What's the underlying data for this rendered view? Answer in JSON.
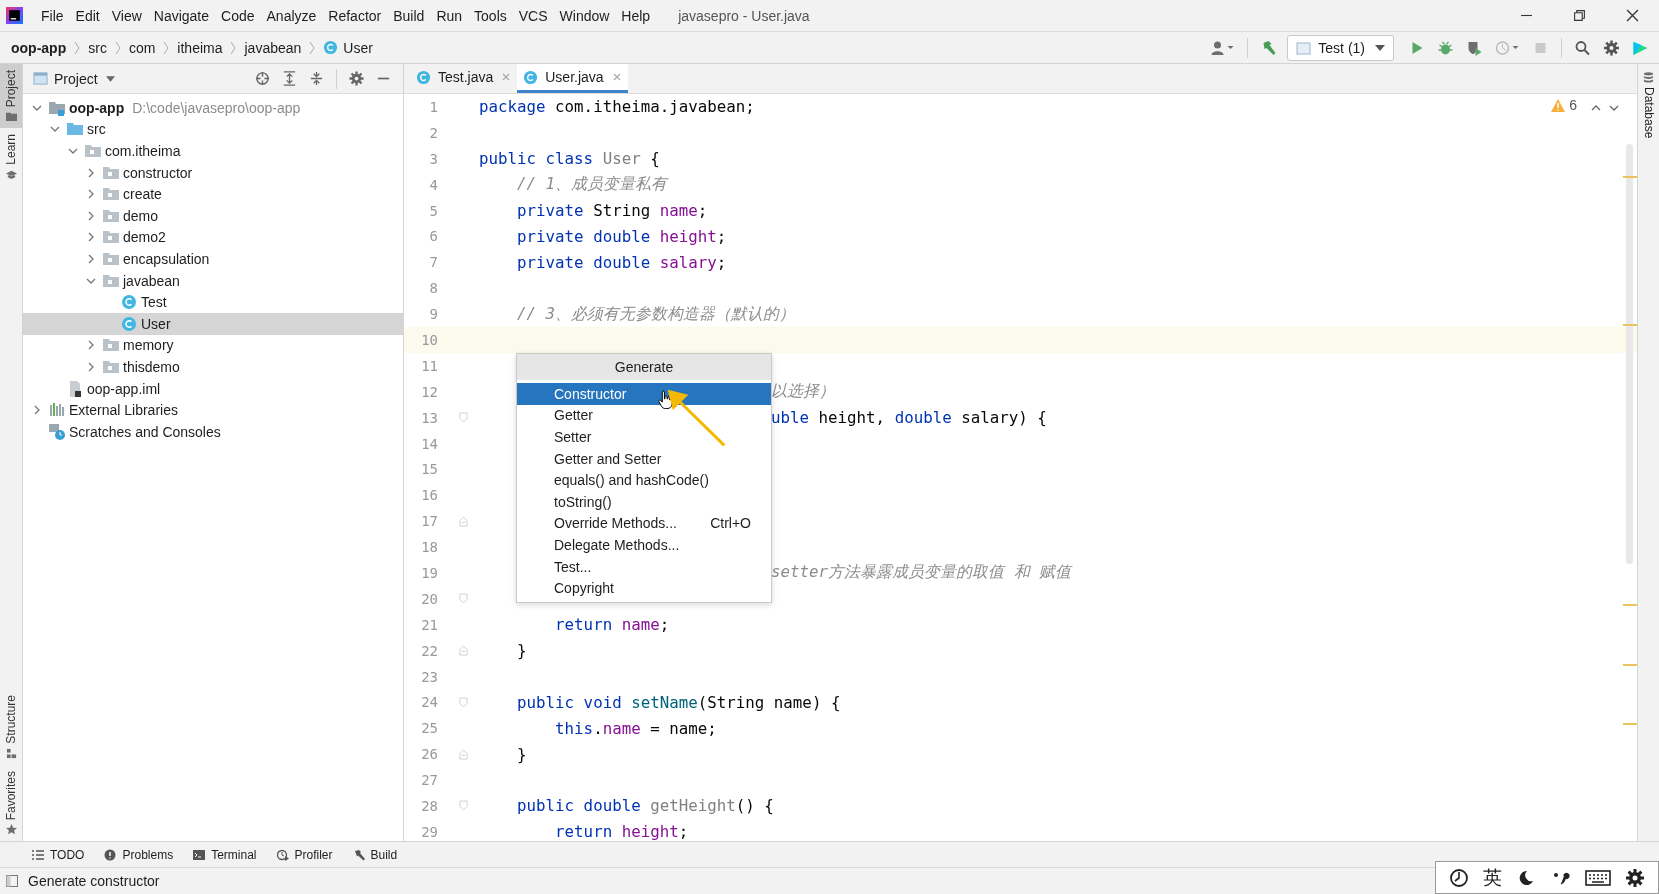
{
  "window": {
    "title": "javasepro - User.java"
  },
  "menu": [
    "File",
    "Edit",
    "View",
    "Navigate",
    "Code",
    "Analyze",
    "Refactor",
    "Build",
    "Run",
    "Tools",
    "VCS",
    "Window",
    "Help"
  ],
  "breadcrumbs": [
    {
      "label": "oop-app",
      "kind": "project"
    },
    {
      "label": "src",
      "kind": "plain"
    },
    {
      "label": "com",
      "kind": "plain"
    },
    {
      "label": "itheima",
      "kind": "plain"
    },
    {
      "label": "javabean",
      "kind": "plain"
    },
    {
      "label": "User",
      "kind": "class"
    }
  ],
  "toolbar": {
    "run_config": "Test (1)"
  },
  "side_tabs_left": [
    {
      "label": "Project",
      "kind": "folder",
      "selected": true
    },
    {
      "label": "Learn",
      "kind": "learn",
      "selected": false
    }
  ],
  "side_tabs_left_bottom": [
    {
      "label": "Structure",
      "kind": "structure"
    },
    {
      "label": "Favorites",
      "kind": "star"
    }
  ],
  "side_tabs_right": [
    {
      "label": "Database"
    }
  ],
  "project_panel": {
    "title": "Project",
    "tree": [
      {
        "label": "oop-app",
        "kind": "project",
        "path": "D:\\code\\javasepro\\oop-app",
        "expanded": true,
        "selected": false,
        "children": [
          {
            "label": "src",
            "kind": "source",
            "expanded": true,
            "selected": false,
            "children": [
              {
                "label": "com.itheima",
                "kind": "package",
                "expanded": true,
                "selected": false,
                "children": [
                  {
                    "label": "constructor",
                    "kind": "package",
                    "expanded": false,
                    "selected": false
                  },
                  {
                    "label": "create",
                    "kind": "package",
                    "expanded": false,
                    "selected": false
                  },
                  {
                    "label": "demo",
                    "kind": "package",
                    "expanded": false,
                    "selected": false
                  },
                  {
                    "label": "demo2",
                    "kind": "package",
                    "expanded": false,
                    "selected": false
                  },
                  {
                    "label": "encapsulation",
                    "kind": "package",
                    "expanded": false,
                    "selected": false
                  },
                  {
                    "label": "javabean",
                    "kind": "package",
                    "expanded": true,
                    "selected": false,
                    "children": [
                      {
                        "label": "Test",
                        "kind": "class",
                        "selected": false
                      },
                      {
                        "label": "User",
                        "kind": "class",
                        "selected": true
                      }
                    ]
                  },
                  {
                    "label": "memory",
                    "kind": "package",
                    "expanded": false,
                    "selected": false
                  },
                  {
                    "label": "thisdemo",
                    "kind": "package",
                    "expanded": false,
                    "selected": false
                  }
                ]
              }
            ]
          },
          {
            "label": "oop-app.iml",
            "kind": "file",
            "selected": false
          }
        ]
      },
      {
        "label": "External Libraries",
        "kind": "library",
        "expanded": false,
        "selected": false
      },
      {
        "label": "Scratches and Consoles",
        "kind": "scratch",
        "selected": false
      }
    ]
  },
  "editor_tabs": [
    {
      "label": "Test.java",
      "selected": false
    },
    {
      "label": "User.java",
      "selected": true
    }
  ],
  "inspections": {
    "warnings": "6"
  },
  "code": [
    {
      "n": "1",
      "tokens": [
        {
          "kind": "kw",
          "text": "package"
        },
        {
          "kind": "plain",
          "text": " com.itheima.javabean;"
        }
      ]
    },
    {
      "n": "2"
    },
    {
      "n": "3",
      "tokens": [
        {
          "kind": "kw",
          "text": "public class "
        },
        {
          "kind": "unused",
          "text": "User"
        },
        {
          "kind": "plain",
          "text": " {"
        }
      ]
    },
    {
      "n": "4",
      "tokens": [
        {
          "kind": "comment",
          "text": "    // 1、成员变量私有"
        }
      ]
    },
    {
      "n": "5",
      "tokens": [
        {
          "kind": "kw",
          "text": "    private "
        },
        {
          "kind": "plain",
          "text": "String "
        },
        {
          "kind": "field",
          "text": "name"
        },
        {
          "kind": "plain",
          "text": ";"
        }
      ]
    },
    {
      "n": "6",
      "tokens": [
        {
          "kind": "kw",
          "text": "    private double "
        },
        {
          "kind": "field",
          "text": "height"
        },
        {
          "kind": "plain",
          "text": ";"
        }
      ]
    },
    {
      "n": "7",
      "tokens": [
        {
          "kind": "kw",
          "text": "    private double "
        },
        {
          "kind": "field",
          "text": "salary"
        },
        {
          "kind": "plain",
          "text": ";"
        }
      ]
    },
    {
      "n": "8"
    },
    {
      "n": "9",
      "tokens": [
        {
          "kind": "comment",
          "text": "    // 3、必须有无参数构造器（默认的）"
        }
      ]
    },
    {
      "n": "10",
      "current": true
    },
    {
      "n": "11"
    },
    {
      "n": "12",
      "tokens": [
        {
          "kind": "comment",
          "text": "以选择）"
        }
      ],
      "after_popup": true
    },
    {
      "n": "13",
      "tokens": [
        {
          "kind": "kw",
          "text": "uble"
        },
        {
          "kind": "plain",
          "text": " height, "
        },
        {
          "kind": "kw",
          "text": "double"
        },
        {
          "kind": "plain",
          "text": " salary) {"
        }
      ],
      "after_popup": true,
      "fold_end": false
    },
    {
      "n": "14"
    },
    {
      "n": "15"
    },
    {
      "n": "16"
    },
    {
      "n": "17",
      "fold_end": true
    },
    {
      "n": "18"
    },
    {
      "n": "19",
      "tokens": [
        {
          "kind": "comment",
          "text": "setter方法暴露成员变量的取值 和 赋值"
        }
      ],
      "after_popup": true
    },
    {
      "n": "20",
      "fold_end": false
    },
    {
      "n": "21",
      "tokens": [
        {
          "kind": "kw",
          "text": "        return "
        },
        {
          "kind": "field",
          "text": "name"
        },
        {
          "kind": "plain",
          "text": ";"
        }
      ]
    },
    {
      "n": "22",
      "tokens": [
        {
          "kind": "plain",
          "text": "    }"
        }
      ],
      "fold_end": true
    },
    {
      "n": "23"
    },
    {
      "n": "24",
      "tokens": [
        {
          "kind": "kw",
          "text": "    public void "
        },
        {
          "kind": "method",
          "text": "setName"
        },
        {
          "kind": "plain",
          "text": "(String name) {"
        }
      ],
      "fold_end": false
    },
    {
      "n": "25",
      "tokens": [
        {
          "kind": "kw",
          "text": "        this"
        },
        {
          "kind": "plain",
          "text": "."
        },
        {
          "kind": "field",
          "text": "name"
        },
        {
          "kind": "plain",
          "text": " = name;"
        }
      ]
    },
    {
      "n": "26",
      "tokens": [
        {
          "kind": "plain",
          "text": "    }"
        }
      ],
      "fold_end": true
    },
    {
      "n": "27"
    },
    {
      "n": "28",
      "tokens": [
        {
          "kind": "kw",
          "text": "    public double "
        },
        {
          "kind": "unused",
          "text": "getHeight"
        },
        {
          "kind": "plain",
          "text": "() {"
        }
      ],
      "fold_end": false
    },
    {
      "n": "29",
      "tokens": [
        {
          "kind": "kw",
          "text": "        return "
        },
        {
          "kind": "field",
          "text": "height"
        },
        {
          "kind": "plain",
          "text": ";"
        }
      ]
    }
  ],
  "popup": {
    "title": "Generate",
    "items": [
      {
        "label": "Constructor",
        "selected": true
      },
      {
        "label": "Getter",
        "selected": false
      },
      {
        "label": "Setter",
        "selected": false
      },
      {
        "label": "Getter and Setter",
        "selected": false
      },
      {
        "label": "equals() and hashCode()",
        "selected": false
      },
      {
        "label": "toString()",
        "selected": false
      },
      {
        "label": "Override Methods...",
        "shortcut": "Ctrl+O",
        "selected": false
      },
      {
        "label": "Delegate Methods...",
        "selected": false
      },
      {
        "label": "Test...",
        "selected": false
      },
      {
        "label": "Copyright",
        "selected": false
      }
    ]
  },
  "bottom_tabs": [
    {
      "label": "TODO",
      "kind": "list"
    },
    {
      "label": "Problems",
      "kind": "problems"
    },
    {
      "label": "Terminal",
      "kind": "terminal"
    },
    {
      "label": "Profiler",
      "kind": "profiler"
    },
    {
      "label": "Build",
      "kind": "build"
    }
  ],
  "status": "Generate constructor",
  "ime": {
    "label": "英"
  }
}
